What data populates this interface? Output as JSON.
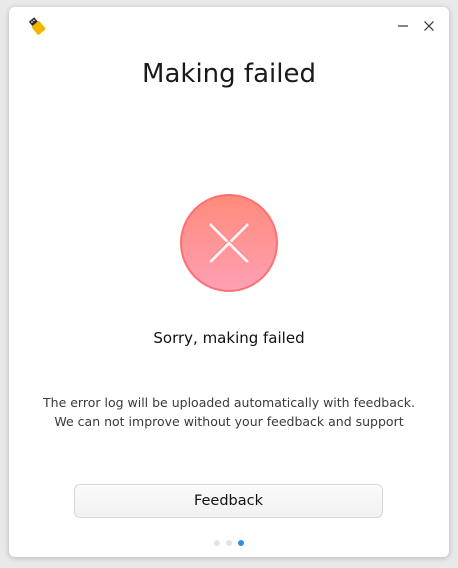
{
  "window": {
    "title": "Making failed",
    "app_icon": "usb-drive-icon",
    "controls": {
      "minimize_icon": "minimize-icon",
      "close_icon": "close-icon"
    }
  },
  "status": {
    "icon": "error-cross-icon",
    "message": "Sorry, making failed",
    "colors": {
      "top": "#ff8c7e",
      "bottom": "#ff9fb3",
      "cross": "#ffffff"
    }
  },
  "info": {
    "line1": "The error log will be uploaded automatically with feedback.",
    "line2": "We can not improve without your feedback and support"
  },
  "actions": {
    "feedback_label": "Feedback"
  },
  "pager": {
    "total": 3,
    "current": 3,
    "active_color": "#2f8fe6"
  }
}
